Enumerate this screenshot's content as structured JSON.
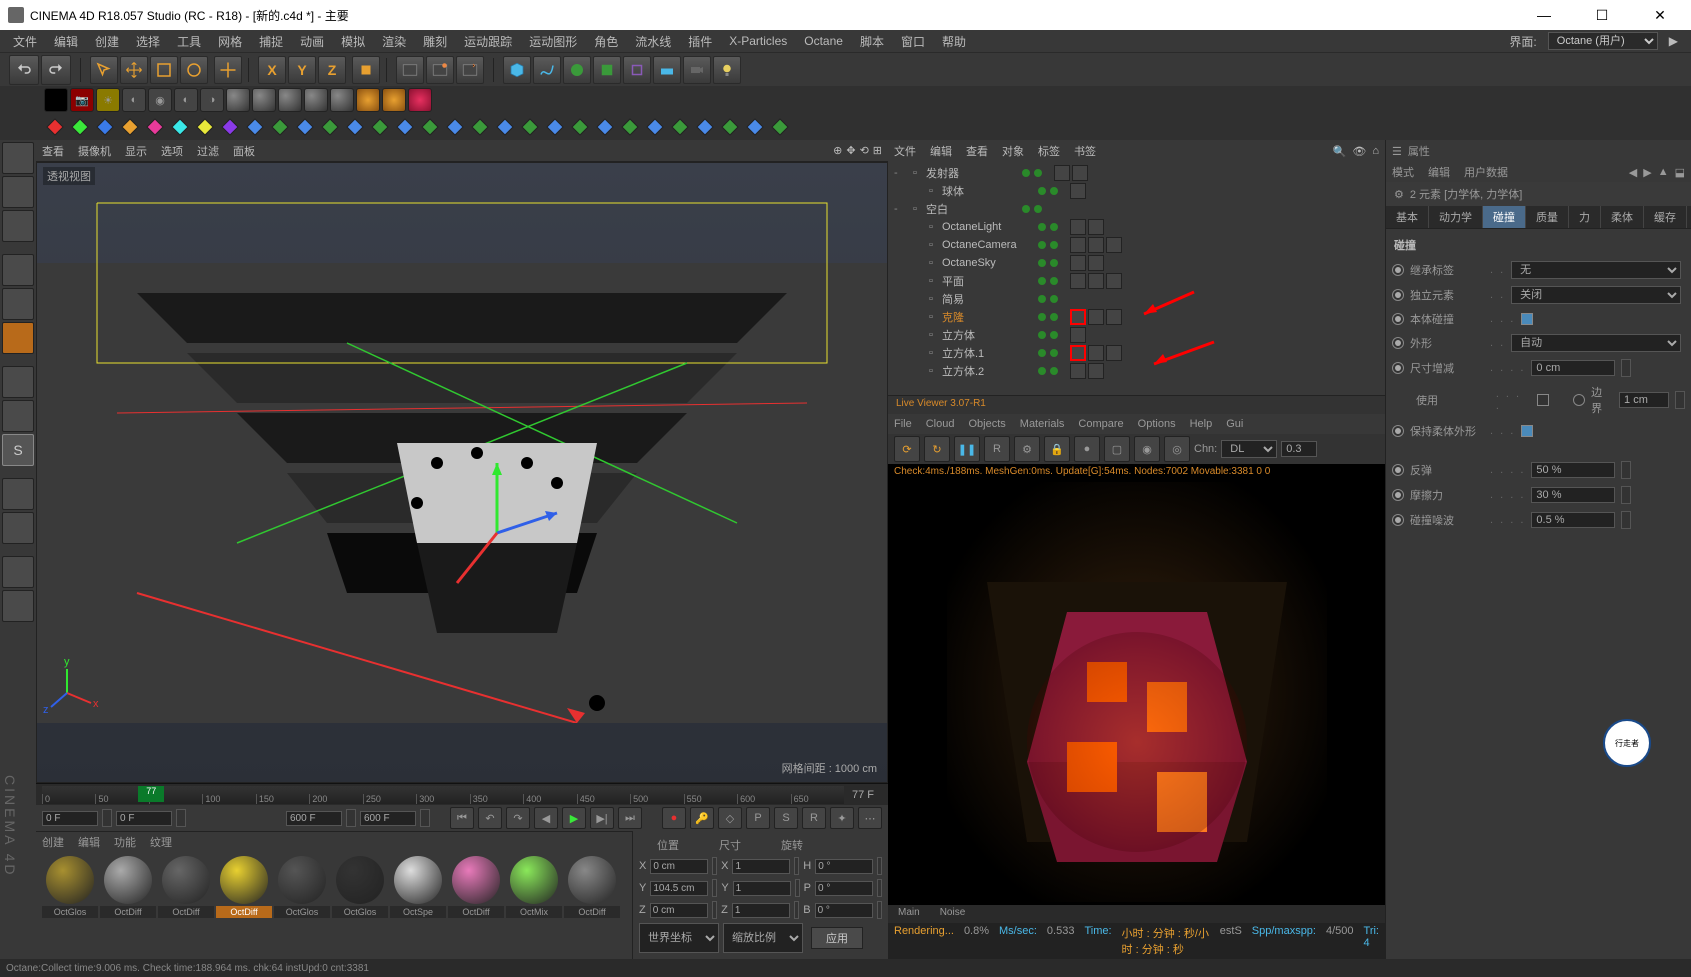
{
  "title": "CINEMA 4D R18.057 Studio (RC - R18) - [新的.c4d *] - 主要",
  "menu": [
    "文件",
    "编辑",
    "创建",
    "选择",
    "工具",
    "网格",
    "捕捉",
    "动画",
    "模拟",
    "渲染",
    "雕刻",
    "运动跟踪",
    "运动图形",
    "角色",
    "流水线",
    "插件",
    "X-Particles",
    "Octane",
    "脚本",
    "窗口",
    "帮助"
  ],
  "layout_label": "界面:",
  "layout_value": "Octane (用户)",
  "vp_menu": [
    "查看",
    "摄像机",
    "显示",
    "选项",
    "过滤",
    "面板"
  ],
  "vp_label": "透视视图",
  "vp_grid": "网格间距 : 1000 cm",
  "timeline": {
    "ticks": [
      "0",
      "50",
      "77",
      "100",
      "150",
      "200",
      "250",
      "300",
      "350",
      "400",
      "450",
      "500",
      "550",
      "600",
      "650"
    ],
    "end": "77 F",
    "marker": "77",
    "f0a": "0 F",
    "f0b": "0 F",
    "f600a": "600 F",
    "f600b": "600 F"
  },
  "mat_menu": [
    "创建",
    "编辑",
    "功能",
    "纹理"
  ],
  "materials": [
    "OctGlos",
    "OctDiff",
    "OctDiff",
    "OctDiff",
    "OctGlos",
    "OctGlos",
    "OctSpe",
    "OctDiff",
    "OctMix",
    "OctDiff"
  ],
  "mat_selected": 3,
  "coord": {
    "hdrs": [
      "位置",
      "尺寸",
      "旋转"
    ],
    "rows": [
      {
        "a": "X",
        "p": "0 cm",
        "s": "1",
        "r": "0 °",
        "sl": "X",
        "rl": "H"
      },
      {
        "a": "Y",
        "p": "104.5 cm",
        "s": "1",
        "r": "0 °",
        "sl": "Y",
        "rl": "P"
      },
      {
        "a": "Z",
        "p": "0 cm",
        "s": "1",
        "r": "0 °",
        "sl": "Z",
        "rl": "B"
      }
    ],
    "sel1": "世界坐标",
    "sel2": "缩放比例",
    "apply": "应用"
  },
  "obj_menu": [
    "文件",
    "编辑",
    "查看",
    "对象",
    "标签",
    "书签"
  ],
  "objects": [
    {
      "exp": "-",
      "name": "发射器",
      "ind": 0,
      "tags": 2
    },
    {
      "name": "球体",
      "ind": 1,
      "tags": 1
    },
    {
      "exp": "-",
      "name": "空白",
      "ind": 0,
      "tags": 0
    },
    {
      "name": "OctaneLight",
      "ind": 1,
      "tags": 2
    },
    {
      "name": "OctaneCamera",
      "ind": 1,
      "tags": 3,
      "red": true
    },
    {
      "name": "OctaneSky",
      "ind": 1,
      "tags": 2
    },
    {
      "name": "平面",
      "ind": 1,
      "tags": 3
    },
    {
      "name": "简易",
      "ind": 1,
      "tags": 0
    },
    {
      "name": "克隆",
      "ind": 1,
      "tags": 3,
      "orange": true,
      "redbox": true
    },
    {
      "name": "立方体",
      "ind": 1,
      "tags": 1
    },
    {
      "name": "立方体.1",
      "ind": 1,
      "tags": 3,
      "redbox": true
    },
    {
      "name": "立方体.2",
      "ind": 1,
      "tags": 2
    }
  ],
  "lv": {
    "title": "Live Viewer 3.07-R1",
    "menu": [
      "File",
      "Cloud",
      "Objects",
      "Materials",
      "Compare",
      "Options",
      "Help",
      "Gui"
    ],
    "chn": "Chn:",
    "dl": "DL",
    "val": "0.3",
    "status": "Check:4ms./188ms. MeshGen:0ms. Update[G]:54ms. Nodes:7002 Movable:3381  0 0",
    "tabs": [
      "Main",
      "Noise"
    ],
    "footer": {
      "rendering": "Rendering...",
      "pct": "0.8%",
      "mssec": "Ms/sec:",
      "msval": "0.533",
      "time": "Time:",
      "tval": "小时 : 分钟 : 秒/小时 : 分钟 : 秒",
      "est": "estS",
      "spp": "Spp/maxspp:",
      "sppval": "4/500",
      "tri": "Tri: 4"
    }
  },
  "attr": {
    "title": "属性",
    "menu": [
      "模式",
      "编辑",
      "用户数据"
    ],
    "obj": "2 元素 [力学体, 力学体]",
    "tabs": [
      "基本",
      "动力学",
      "碰撞",
      "质量",
      "力",
      "柔体",
      "缓存"
    ],
    "active_tab": 2,
    "section": "碰撞",
    "rows": [
      {
        "type": "sel",
        "label": "继承标签",
        "val": "无"
      },
      {
        "type": "sel",
        "label": "独立元素",
        "val": "关闭"
      },
      {
        "type": "chk",
        "label": "本体碰撞",
        "on": true
      },
      {
        "type": "sel",
        "label": "外形",
        "val": "自动"
      },
      {
        "type": "num",
        "label": "尺寸增减",
        "val": "0 cm"
      },
      {
        "type": "chk2",
        "label": "使用",
        "label2": "边界",
        "val2": "1 cm"
      },
      {
        "type": "chk",
        "label": "保持柔体外形",
        "on": true
      },
      {
        "type": "gap"
      },
      {
        "type": "num",
        "label": "反弹",
        "val": "50 %"
      },
      {
        "type": "num",
        "label": "摩擦力",
        "val": "30 %"
      },
      {
        "type": "num",
        "label": "碰撞噪波",
        "val": "0.5 %"
      }
    ]
  },
  "statusbar": "Octane:Collect time:9.006 ms.  Check time:188.964 ms.  chk:64  instUpd:0  cnt:3381",
  "logo": "行走者"
}
